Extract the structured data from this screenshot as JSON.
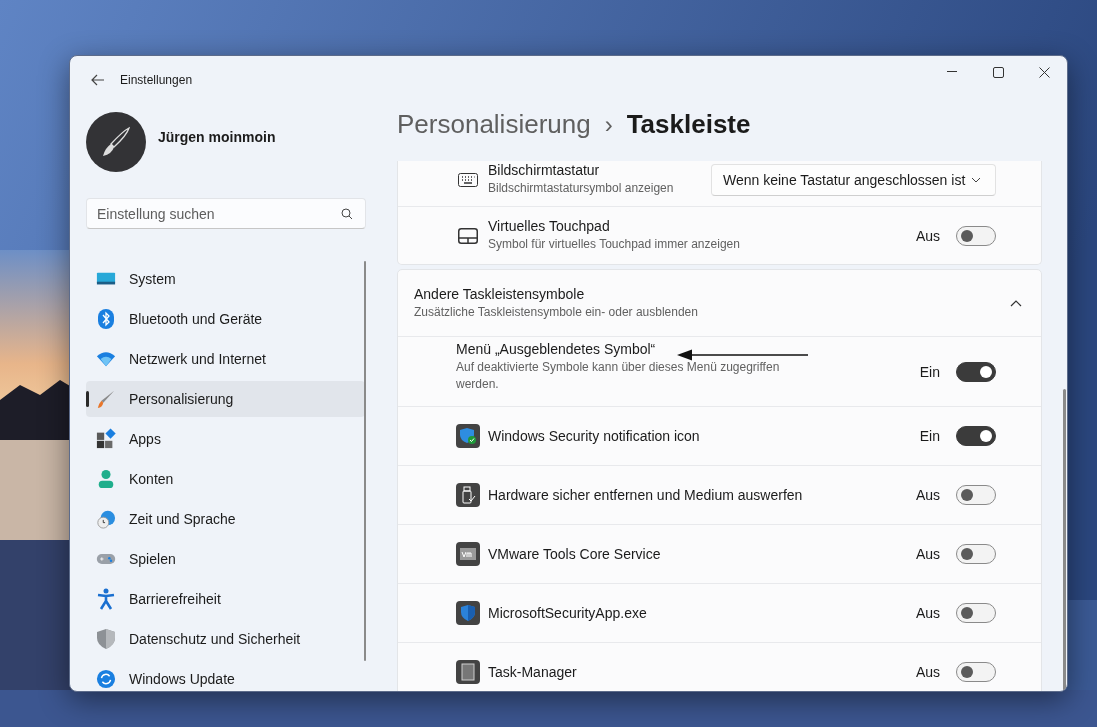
{
  "window": {
    "title": "Einstellungen"
  },
  "profile": {
    "name": "Jürgen moinmoin"
  },
  "search": {
    "placeholder": "Einstellung suchen"
  },
  "sidebar": {
    "items": [
      {
        "label": "System",
        "selected": false
      },
      {
        "label": "Bluetooth und Geräte",
        "selected": false
      },
      {
        "label": "Netzwerk und Internet",
        "selected": false
      },
      {
        "label": "Personalisierung",
        "selected": true
      },
      {
        "label": "Apps",
        "selected": false
      },
      {
        "label": "Konten",
        "selected": false
      },
      {
        "label": "Zeit und Sprache",
        "selected": false
      },
      {
        "label": "Spielen",
        "selected": false
      },
      {
        "label": "Barrierefreiheit",
        "selected": false
      },
      {
        "label": "Datenschutz und Sicherheit",
        "selected": false
      },
      {
        "label": "Windows Update",
        "selected": false
      }
    ]
  },
  "breadcrumb": {
    "parent": "Personalisierung",
    "separator": "›",
    "current": "Taskleiste"
  },
  "settings": [
    {
      "kind": "dropdown",
      "title": "Bildschirmtastatur",
      "subtitle": "Bildschirmtastatursymbol anzeigen",
      "value": "Wenn keine Tastatur angeschlossen ist"
    },
    {
      "kind": "toggle",
      "title": "Virtuelles Touchpad",
      "subtitle": "Symbol für virtuelles Touchpad immer anzeigen",
      "state_label": "Aus",
      "on": false
    }
  ],
  "group": {
    "title": "Andere Taskleistensymbole",
    "subtitle": "Zusätzliche Taskleistensymbole ein- oder ausblenden",
    "expanded": true,
    "rows": [
      {
        "title": "Menü „Ausgeblendetes Symbol“",
        "subtitle": "Auf deaktivierte Symbole kann über dieses Menü zugegriffen werden.",
        "state_label": "Ein",
        "on": true
      },
      {
        "title": "Windows Security notification icon",
        "state_label": "Ein",
        "on": true
      },
      {
        "title": "Hardware sicher entfernen und Medium auswerfen",
        "state_label": "Aus",
        "on": false
      },
      {
        "title": "VMware Tools Core Service",
        "state_label": "Aus",
        "on": false
      },
      {
        "title": "MicrosoftSecurityApp.exe",
        "state_label": "Aus",
        "on": false
      },
      {
        "title": "Task-Manager",
        "state_label": "Aus",
        "on": false
      }
    ]
  }
}
